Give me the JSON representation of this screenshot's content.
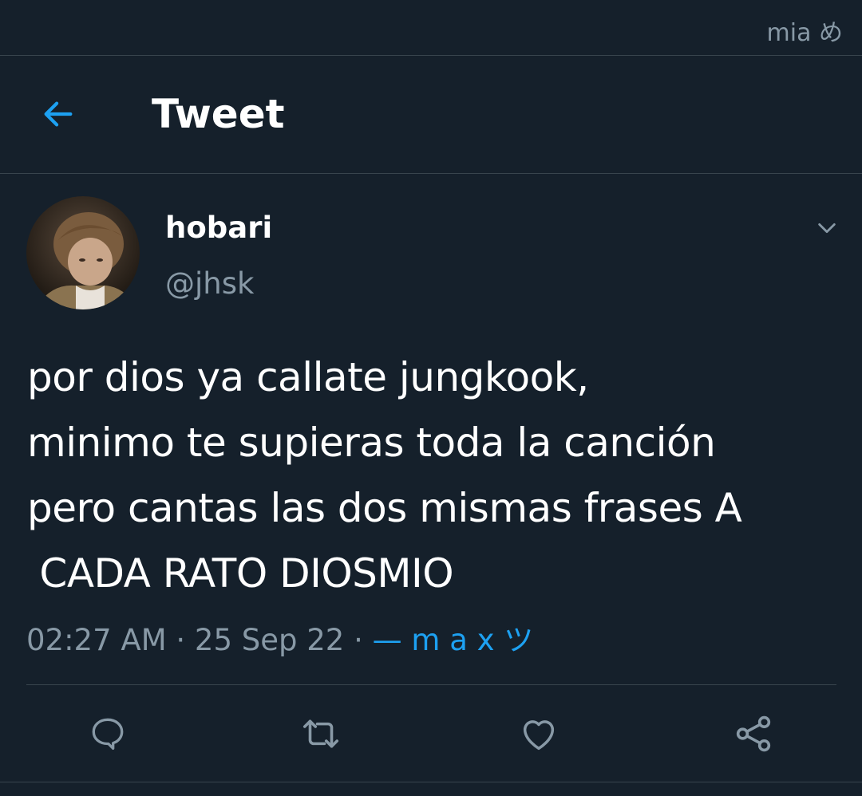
{
  "status_bar": {
    "text": "mia め"
  },
  "header": {
    "title": "Tweet",
    "back_icon": "arrow-left-icon"
  },
  "tweet": {
    "author": {
      "name": "hobari",
      "handle": "@jhsk",
      "avatar": "avatar-photo"
    },
    "text": "por dios ya callate jungkook,\nminimo te supieras toda la canción\npero cantas las dos mismas frases A\n CADA RATO DIOSMIO",
    "time": "02:27 AM",
    "date": "25 Sep 22",
    "separator": "·",
    "source": "— m a x ツ"
  },
  "actions": [
    {
      "icon": "reply-icon"
    },
    {
      "icon": "retweet-icon"
    },
    {
      "icon": "like-icon"
    },
    {
      "icon": "share-icon"
    }
  ],
  "colors": {
    "background": "#15202b",
    "accent": "#1da1f2",
    "muted": "#8899a6",
    "divider": "#38444d"
  }
}
